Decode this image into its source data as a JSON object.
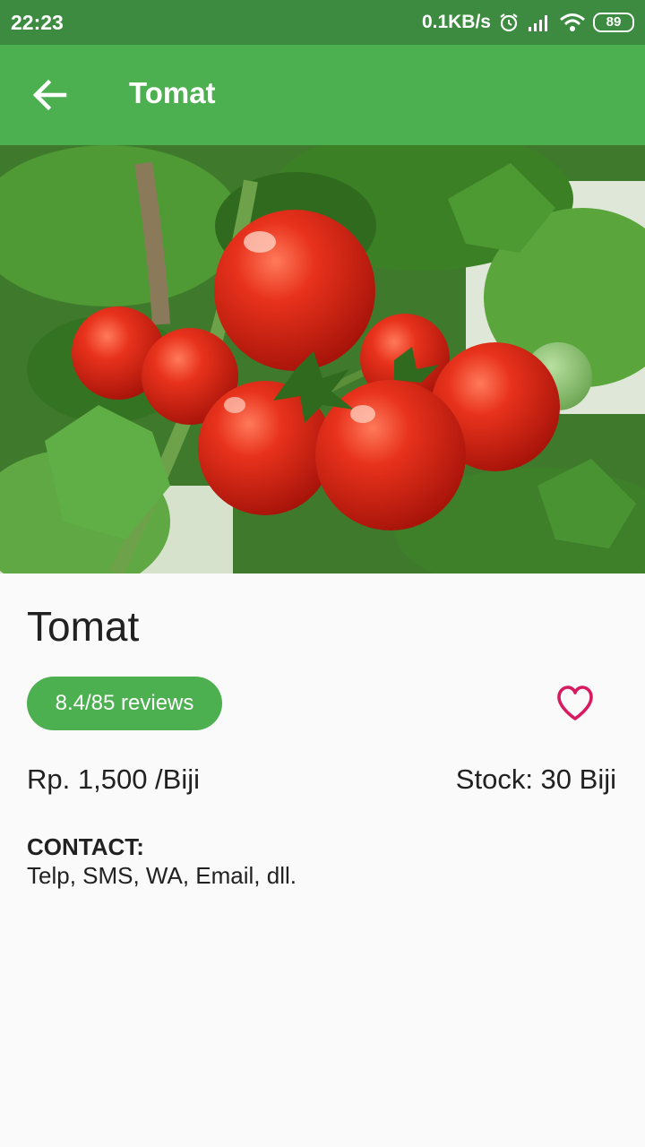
{
  "status_bar": {
    "time": "22:23",
    "network_speed": "0.1KB/s",
    "battery_level": "89",
    "icons": [
      "alarm-icon",
      "signal-icon",
      "wifi-icon",
      "battery-icon"
    ]
  },
  "app_bar": {
    "back_icon": "arrow-back-icon",
    "title": "Tomat"
  },
  "product": {
    "name": "Tomat",
    "reviews_label": "8.4/85 reviews",
    "favorite_icon": "heart-outline-icon",
    "price": "Rp. 1,500 /Biji",
    "stock": "Stock: 30 Biji"
  },
  "contact": {
    "heading": "CONTACT:",
    "text": "Telp, SMS, WA, Email, dll."
  },
  "colors": {
    "status_bar": "#3d8b40",
    "app_bar": "#4caf50",
    "chip": "#4caf50",
    "favorite": "#d81b60",
    "background": "#fafafa"
  }
}
